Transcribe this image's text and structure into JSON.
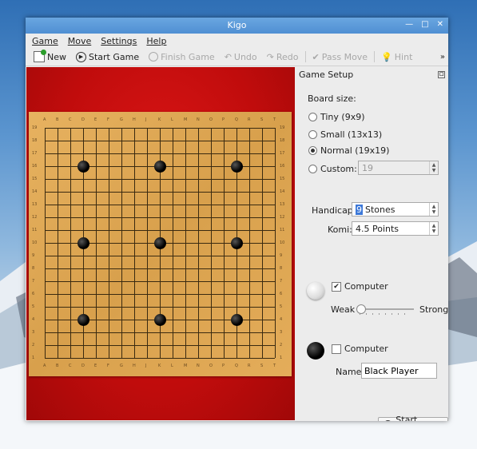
{
  "window": {
    "title": "Kigo"
  },
  "menu": [
    "Game",
    "Move",
    "Settings",
    "Help"
  ],
  "toolbar": {
    "new": "New",
    "start_game": "Start Game",
    "finish_game": "Finish Game",
    "undo": "Undo",
    "redo": "Redo",
    "pass_move": "Pass Move",
    "hint": "Hint",
    "overflow": "»"
  },
  "board": {
    "size": 19,
    "col_labels": [
      "A",
      "B",
      "C",
      "D",
      "E",
      "F",
      "G",
      "H",
      "J",
      "K",
      "L",
      "M",
      "N",
      "O",
      "P",
      "Q",
      "R",
      "S",
      "T"
    ],
    "stones": [
      {
        "col": "D",
        "row": 16,
        "color": "black"
      },
      {
        "col": "K",
        "row": 16,
        "color": "black"
      },
      {
        "col": "Q",
        "row": 16,
        "color": "black"
      },
      {
        "col": "D",
        "row": 10,
        "color": "black"
      },
      {
        "col": "K",
        "row": 10,
        "color": "black"
      },
      {
        "col": "Q",
        "row": 10,
        "color": "black"
      },
      {
        "col": "D",
        "row": 4,
        "color": "black"
      },
      {
        "col": "K",
        "row": 4,
        "color": "black"
      },
      {
        "col": "Q",
        "row": 4,
        "color": "black"
      }
    ]
  },
  "setup": {
    "title": "Game Setup",
    "board_size_label": "Board size:",
    "sizes": [
      {
        "label": "Tiny (9x9)",
        "selected": false
      },
      {
        "label": "Small (13x13)",
        "selected": false
      },
      {
        "label": "Normal (19x19)",
        "selected": true
      },
      {
        "label": "Custom:",
        "selected": false
      }
    ],
    "custom_value": "19",
    "handicap_label": "Handicap:",
    "handicap_value": "Stones",
    "handicap_number": "9",
    "komi_label": "Komi:",
    "komi_value": "4.5 Points",
    "white": {
      "computer_label": "Computer",
      "computer_checked": true,
      "weak_label": "Weak",
      "strong_label": "Strong",
      "strength": 0
    },
    "black": {
      "computer_label": "Computer",
      "computer_checked": false,
      "name_label": "Name:",
      "name_value": "Black Player"
    },
    "start_button": "Start Game"
  },
  "colors": {
    "titlebar": "#4f8fd3",
    "board_bg": "#c00c0c",
    "board_wood": "#dca450"
  }
}
